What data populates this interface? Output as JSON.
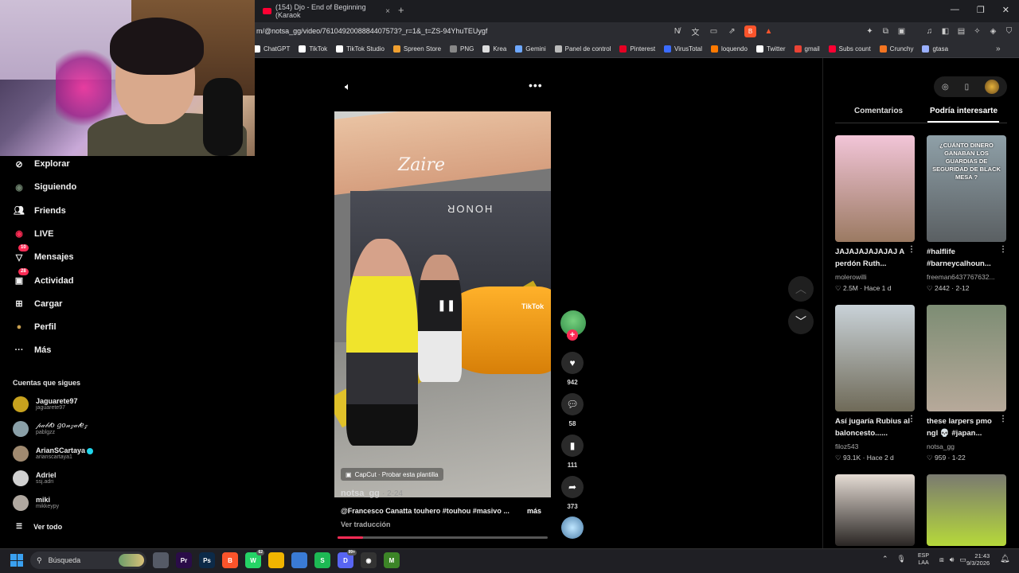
{
  "browser": {
    "tab_title": "(154) Djo - End of Beginning (Karaok",
    "url": "m/@notsa_gg/video/7610492008884407573?_r=1&_t=ZS-94YhuTEUygf",
    "bookmarks": [
      {
        "label": "ChatGPT",
        "icon": "chatgpt-icon",
        "color": "#ffffff"
      },
      {
        "label": "TikTok",
        "icon": "tiktok-icon",
        "color": "#ffffff"
      },
      {
        "label": "TikTok Studio",
        "icon": "tiktok-icon",
        "color": "#ffffff"
      },
      {
        "label": "Spreen Store",
        "icon": "store-icon",
        "color": "#f0a030"
      },
      {
        "label": "PNG",
        "icon": "png-icon",
        "color": "#888888"
      },
      {
        "label": "Krea",
        "icon": "krea-icon",
        "color": "#dddddd"
      },
      {
        "label": "Gemini",
        "icon": "gemini-icon",
        "color": "#6ea8ff"
      },
      {
        "label": "Panel de control",
        "icon": "panel-icon",
        "color": "#bbbbbb"
      },
      {
        "label": "Pinterest",
        "icon": "pinterest-icon",
        "color": "#e60023"
      },
      {
        "label": "VirusTotal",
        "icon": "virustotal-icon",
        "color": "#3b6cff"
      },
      {
        "label": "loquendo",
        "icon": "loquendo-icon",
        "color": "#ff7a00"
      },
      {
        "label": "Twitter",
        "icon": "x-icon",
        "color": "#ffffff"
      },
      {
        "label": "gmail",
        "icon": "gmail-icon",
        "color": "#ea4335"
      },
      {
        "label": "Subs count",
        "icon": "youtube-icon",
        "color": "#ff0033"
      },
      {
        "label": "Crunchy",
        "icon": "crunchyroll-icon",
        "color": "#f47521"
      },
      {
        "label": "gtasa",
        "icon": "folder-icon",
        "color": "#9ab0ff"
      }
    ]
  },
  "sidebar": {
    "items": [
      {
        "label": "Explorar",
        "icon": "compass-icon"
      },
      {
        "label": "Siguiendo",
        "icon": "following-icon"
      },
      {
        "label": "Friends",
        "icon": "friends-icon"
      },
      {
        "label": "LIVE",
        "icon": "live-icon"
      },
      {
        "label": "Mensajes",
        "icon": "messages-icon",
        "badge": "10"
      },
      {
        "label": "Actividad",
        "icon": "activity-icon",
        "badge": "28"
      },
      {
        "label": "Cargar",
        "icon": "upload-icon"
      },
      {
        "label": "Perfil",
        "icon": "profile-icon"
      },
      {
        "label": "Más",
        "icon": "more-icon"
      }
    ],
    "following_heading": "Cuentas que sigues",
    "accounts": [
      {
        "name": "Jaguarete97",
        "handle": "jaguarete97",
        "color": "#c8a21e"
      },
      {
        "name": "𝓅𝒶𝒷𝓁𝑜 𝑔𝑜𝓃𝓏𝒶𝓁𝑒𝓏",
        "handle": "pablgzz",
        "color": "#8aa0a8"
      },
      {
        "name": "ArianSCartaya",
        "handle": "arianscartaya1",
        "color": "#a08a70",
        "verified": true
      },
      {
        "name": "Adriel",
        "handle": "ssj.adri",
        "color": "#d0d0d0"
      },
      {
        "name": "miki",
        "handle": "mikkeypy",
        "color": "#b0a8a0"
      }
    ],
    "see_all": "Ver todo"
  },
  "video": {
    "author": "notsa_gg",
    "date": "2-24",
    "caption": "@Francesco Canatta  touhero #touhou #masivo ...",
    "more": "más",
    "translate": "Ver traducción",
    "capcut": "CapCut · Probar esta plantilla",
    "store_sign": "HONOR",
    "brand": "Zaire",
    "watermark": "TikTok",
    "progress": 0.12,
    "actions": {
      "likes": "942",
      "comments": "58",
      "saves": "111",
      "shares": "373"
    }
  },
  "right_panel": {
    "tabs": [
      "Comentarios",
      "Podría interesarte"
    ],
    "active_tab": "Podría interesarte",
    "cards": [
      {
        "title": "JAJAJAJAJAJAJ A perdón Ruth...",
        "user": "molerowilli",
        "likes": "2.5M",
        "time": "Hace 1 d",
        "colors": [
          "#f2c5d8",
          "#9b7a62"
        ]
      },
      {
        "title": "#halflife #barneycalhoun...",
        "user": "freeman6437767632...",
        "likes": "2442",
        "time": "2-12",
        "colors": [
          "#8fa0a8",
          "#5a5f62"
        ],
        "overlay": "¿CUÁNTO DINERO GANABAN LOS GUARDIAS DE SEGURIDAD DE BLACK MESA ?"
      },
      {
        "title": "Así jugaría Rubius al baloncesto......",
        "user": "filoz543",
        "likes": "93.1K",
        "time": "Hace 2 d",
        "colors": [
          "#c9d2d8",
          "#6f6a58"
        ]
      },
      {
        "title": "these larpers pmo ngl 💀 #japan...",
        "user": "notsa_gg",
        "likes": "959",
        "time": "1-22",
        "colors": [
          "#7d8d74",
          "#b7a99a"
        ]
      },
      {
        "title": "",
        "user": "",
        "likes": "",
        "time": "",
        "colors": [
          "#e5dcd4",
          "#2a2624"
        ]
      },
      {
        "title": "",
        "user": "",
        "likes": "",
        "time": "",
        "colors": [
          "#7a7a70",
          "#b6d93a"
        ]
      }
    ]
  },
  "taskbar": {
    "search_placeholder": "Búsqueda",
    "apps": [
      {
        "icon": "task-view-icon",
        "color": "#555a66",
        "text": ""
      },
      {
        "icon": "premiere-icon",
        "color": "#2a0c48",
        "text": "Pr"
      },
      {
        "icon": "photoshop-icon",
        "color": "#0c2a48",
        "text": "Ps"
      },
      {
        "icon": "brave-icon",
        "color": "#fb542b",
        "text": "B"
      },
      {
        "icon": "whatsapp-icon",
        "color": "#25d366",
        "text": "W",
        "badge": "62"
      },
      {
        "icon": "file-explorer-icon",
        "color": "#f0b400",
        "text": ""
      },
      {
        "icon": "microsoft-store-icon",
        "color": "#3a7bd5",
        "text": ""
      },
      {
        "icon": "spotify-icon",
        "color": "#1db954",
        "text": "S"
      },
      {
        "icon": "discord-icon",
        "color": "#5865f2",
        "text": "D",
        "badge": "99+"
      },
      {
        "icon": "obs-icon",
        "color": "#333333",
        "text": "◉"
      },
      {
        "icon": "minecraft-icon",
        "color": "#3c8527",
        "text": "M"
      }
    ],
    "lang_line1": "ESP",
    "lang_line2": "LAA",
    "time": "21:43",
    "date": "9/3/2026"
  }
}
